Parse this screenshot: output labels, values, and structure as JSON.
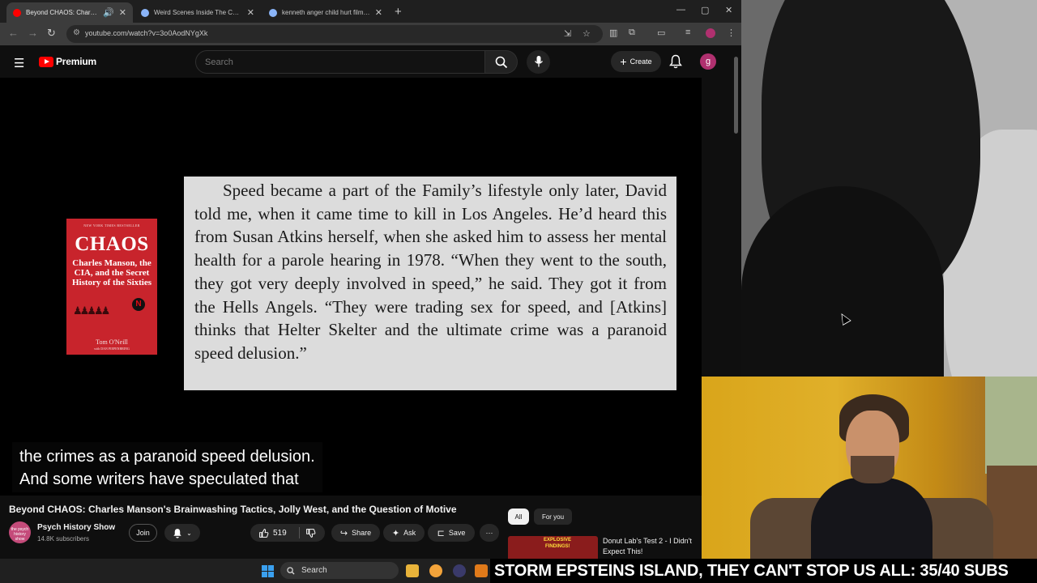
{
  "browser": {
    "tabs": [
      {
        "title": "Beyond CHAOS: Charles M",
        "active": true,
        "favicon_color": "#ff0000"
      },
      {
        "title": "Weird Scenes Inside The Canyo",
        "active": false,
        "favicon_color": "#8ab4f8"
      },
      {
        "title": "kenneth anger child hurt filmed",
        "active": false,
        "favicon_color": "#8ab4f8"
      }
    ],
    "new_tab_icon": "plus-icon",
    "url": "youtube.com/watch?v=3o0AodNYgXk",
    "profile_initial": "g"
  },
  "youtube": {
    "logo_text": "Premium",
    "search_placeholder": "Search",
    "create_label": "Create",
    "avatar_initial": "g"
  },
  "video": {
    "book": {
      "badge": "NEW YORK TIMES BESTSELLER",
      "title": "CHAOS",
      "subtitle": "Charles Manson, the CIA, and the Secret History of the Sixties",
      "netflix_badge": "N",
      "author": "Tom O'Neill",
      "coauthor": "with DAN PIEPENBRING"
    },
    "page_text": "Speed became a part of the Family’s lifestyle only later, David told me, when it came time to kill in Los Angeles. He’d heard this from Susan Atkins herself, when she asked him to assess her mental health for a parole hearing in 1978. “When they went to the south, they got very deeply involved in speed,” he said. They got it from the Hells Angels. “They were trading sex for speed, and [Atkins] thinks that Helter Skelter and the ultimate crime was a paranoid speed delusion.”",
    "caption_line1": "the crimes as a paranoid speed delusion.",
    "caption_line2": "And some writers have speculated that"
  },
  "meta": {
    "title": "Beyond CHAOS: Charles Manson's Brainwashing Tactics, Jolly West, and the Question of Motive",
    "channel_name": "Psych History Show",
    "channel_subs": "14.8K subscribers",
    "channel_avatar_text": "the psych history show",
    "join_label": "Join",
    "like_count": "519",
    "share_label": "Share",
    "ask_label": "Ask",
    "save_label": "Save",
    "more_label": "···"
  },
  "recommendations": {
    "chips": [
      "All",
      "For you"
    ],
    "items": [
      {
        "title": "Donut Lab's Test 2 - I Didn't Expect This!",
        "thumb_text1": "EXPLOSIVE",
        "thumb_text2": "FINDINGS!"
      }
    ]
  },
  "taskbar": {
    "search_placeholder": "Search"
  },
  "overlay": {
    "ticker": "STORM EPSTEINS ISLAND, THEY CAN'T STOP US ALL: 35/40 SUBS"
  }
}
